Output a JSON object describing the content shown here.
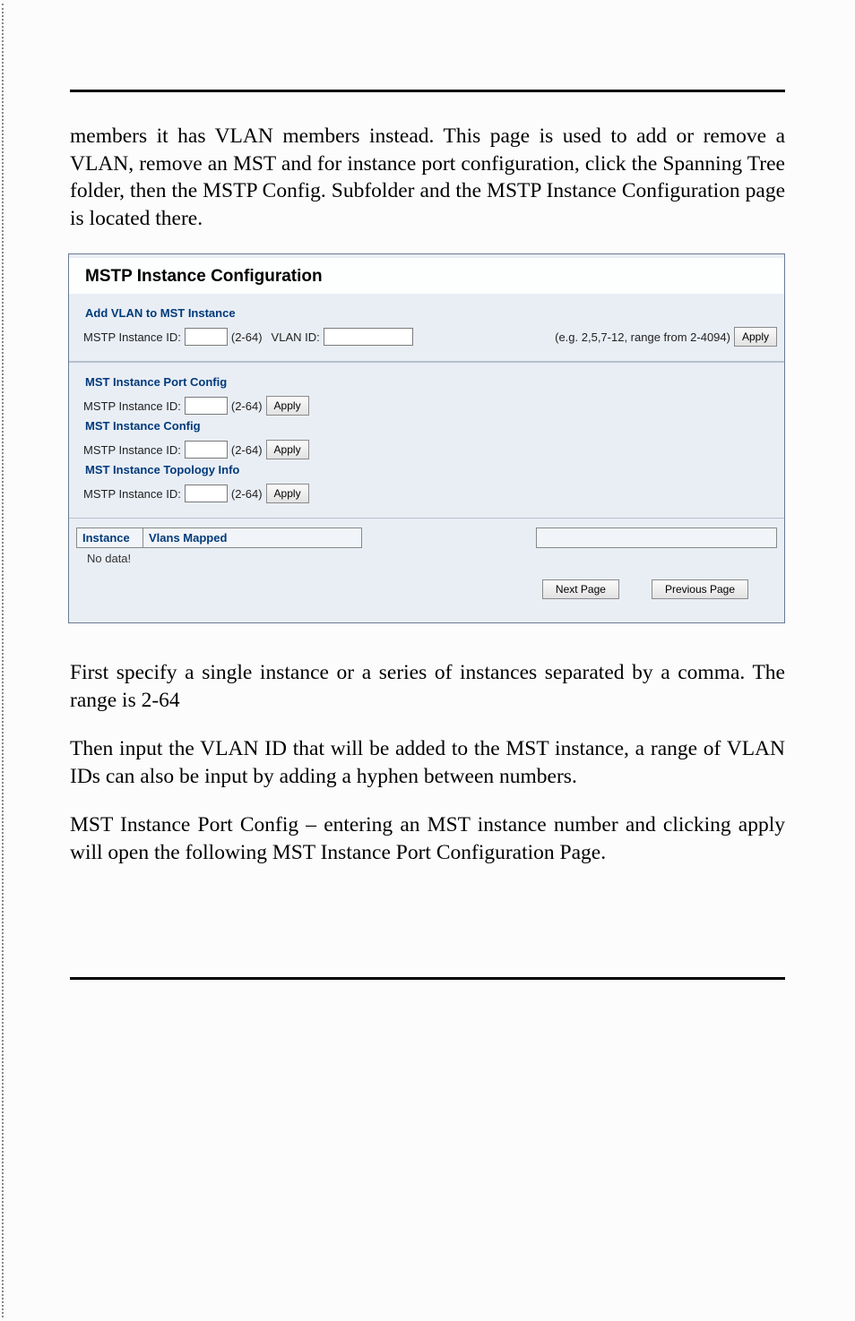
{
  "doc": {
    "para1": "members it has VLAN members instead.  This page is used to add or remove a VLAN, remove an MST and for instance port configuration, click the Spanning Tree folder, then the MSTP Config. Subfolder and the MSTP Instance Configuration page is located there.",
    "para2": "First specify a single instance or a series of instances separated by a comma. The range is 2-64",
    "para3": "Then input the VLAN ID that will be added to the MST instance, a range of VLAN IDs can also be input by adding a hyphen between numbers.",
    "para4": "MST Instance Port Config – entering an MST instance number and clicking apply will open the following MST Instance Port Configuration Page."
  },
  "ui": {
    "title": "MSTP Instance Configuration",
    "add_vlan": {
      "heading": "Add VLAN to MST Instance",
      "mstp_label": "MSTP Instance ID:",
      "mstp_range": "(2-64)",
      "vlan_label": "VLAN ID:",
      "vlan_hint": "(e.g. 2,5,7-12, range from 2-4094)",
      "apply": "Apply"
    },
    "port_config": {
      "heading": "MST Instance Port Config",
      "label": "MSTP Instance ID:",
      "range": "(2-64)",
      "apply": "Apply"
    },
    "inst_config": {
      "heading": "MST Instance Config",
      "label": "MSTP Instance ID:",
      "range": "(2-64)",
      "apply": "Apply"
    },
    "topo": {
      "heading": "MST Instance Topology Info",
      "label": "MSTP Instance ID:",
      "range": "(2-64)",
      "apply": "Apply"
    },
    "table": {
      "col_instance": "Instance",
      "col_vlans": "Vlans Mapped",
      "no_data": "No data!"
    },
    "pager": {
      "next": "Next Page",
      "prev": "Previous Page"
    }
  }
}
